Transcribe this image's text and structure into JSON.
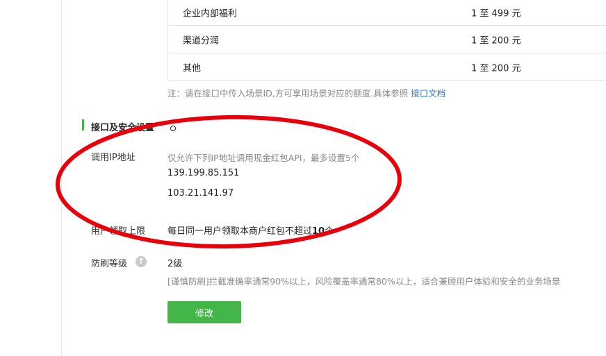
{
  "quota_table": {
    "rows": [
      {
        "scene": "企业内部福利",
        "range": "1 至 499 元"
      },
      {
        "scene": "渠道分润",
        "range": "1 至 200 元"
      },
      {
        "scene": "其他",
        "range": "1 至 200 元"
      }
    ]
  },
  "note": {
    "text": "注：请在接口中传入场景ID,方可享用场景对应的额度.具体参照 ",
    "link": "接口文档"
  },
  "section": {
    "title": "接口及安全设置"
  },
  "ip_setting": {
    "label": "调用IP地址",
    "hint": "仅允许下列IP地址调用现金红包API，最多设置5个",
    "ips": [
      "139.199.85.151",
      "103.21.141.97"
    ]
  },
  "user_limit": {
    "label": "用户领取上限",
    "text_prefix": "每日同一用户领取本商户红包不超过",
    "count": "10",
    "text_suffix": "个"
  },
  "anti_fraud": {
    "label": "防刷等级",
    "help_icon": "question-icon",
    "level": "2级",
    "description": "[谨慎防刷]拦截准确率通常90%以上，风险覆盖率通常80%以上，适合兼顾用户体验和安全的业务场景"
  },
  "actions": {
    "edit_label": "修改"
  },
  "colors": {
    "accent_green": "#44b549",
    "link_blue": "#2a78c8",
    "annotation_red": "#e8000b"
  }
}
